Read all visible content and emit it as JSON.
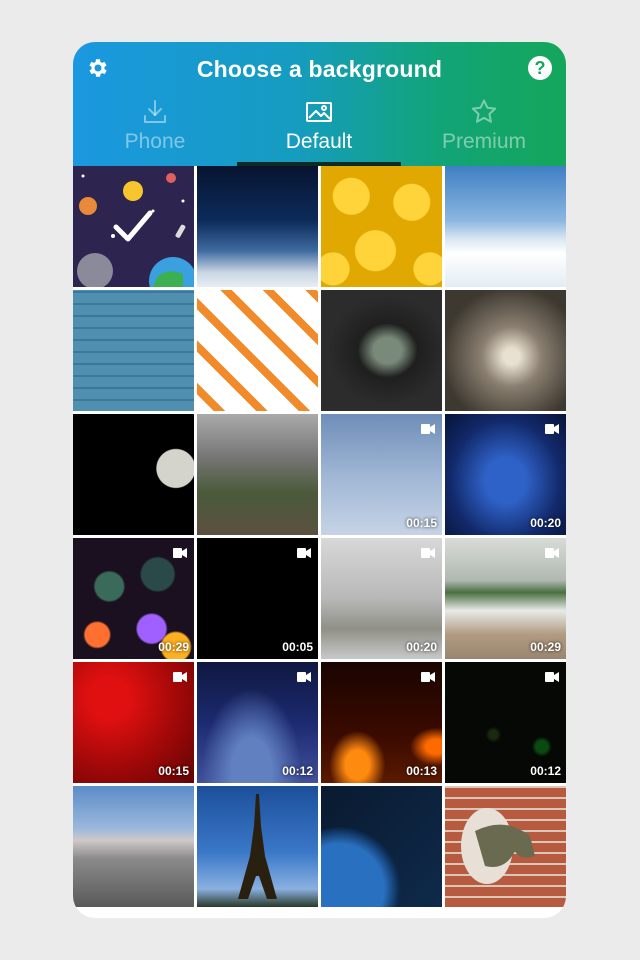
{
  "header": {
    "title": "Choose a background",
    "settings_icon": "gear-icon",
    "help_icon": "question-icon",
    "help_glyph": "?",
    "gradient_start": "#1b98e0",
    "gradient_end": "#14a65a"
  },
  "tabs": [
    {
      "label": "Phone",
      "icon": "download-icon",
      "active": false
    },
    {
      "label": "Default",
      "icon": "image-icon",
      "active": true
    },
    {
      "label": "Premium",
      "icon": "star-icon",
      "active": false
    }
  ],
  "tiles": [
    {
      "name": "space-planets",
      "selected": true,
      "video": false,
      "duration": ""
    },
    {
      "name": "earth-horizon",
      "selected": false,
      "video": false,
      "duration": ""
    },
    {
      "name": "emoji-faces",
      "selected": false,
      "video": false,
      "duration": ""
    },
    {
      "name": "snowy-mountains",
      "selected": false,
      "video": false,
      "duration": ""
    },
    {
      "name": "blue-brick-wall",
      "selected": false,
      "video": false,
      "duration": ""
    },
    {
      "name": "pizza-pattern",
      "selected": false,
      "video": false,
      "duration": ""
    },
    {
      "name": "tunnel-road",
      "selected": false,
      "video": false,
      "duration": ""
    },
    {
      "name": "stone-corridor",
      "selected": false,
      "video": false,
      "duration": ""
    },
    {
      "name": "moon",
      "selected": false,
      "video": false,
      "duration": ""
    },
    {
      "name": "eiffel-aerial",
      "selected": false,
      "video": false,
      "duration": ""
    },
    {
      "name": "snow-fall",
      "selected": false,
      "video": true,
      "duration": "00:15"
    },
    {
      "name": "blue-glow",
      "selected": false,
      "video": true,
      "duration": "00:20"
    },
    {
      "name": "bokeh-lights",
      "selected": false,
      "video": true,
      "duration": "00:29"
    },
    {
      "name": "black-screen",
      "selected": false,
      "video": true,
      "duration": "00:05"
    },
    {
      "name": "snowy-trees",
      "selected": false,
      "video": true,
      "duration": "00:20"
    },
    {
      "name": "beach-waves",
      "selected": false,
      "video": true,
      "duration": "00:29"
    },
    {
      "name": "red-gradient",
      "selected": false,
      "video": true,
      "duration": "00:15"
    },
    {
      "name": "stage-lights",
      "selected": false,
      "video": true,
      "duration": "00:12"
    },
    {
      "name": "fire",
      "selected": false,
      "video": true,
      "duration": "00:13"
    },
    {
      "name": "dark-particles",
      "selected": false,
      "video": true,
      "duration": "00:12"
    },
    {
      "name": "city-skyline",
      "selected": false,
      "video": false,
      "duration": ""
    },
    {
      "name": "eiffel-tower",
      "selected": false,
      "video": false,
      "duration": ""
    },
    {
      "name": "earth-meteors",
      "selected": false,
      "video": false,
      "duration": ""
    },
    {
      "name": "dinosaur-wall",
      "selected": false,
      "video": false,
      "duration": ""
    }
  ]
}
